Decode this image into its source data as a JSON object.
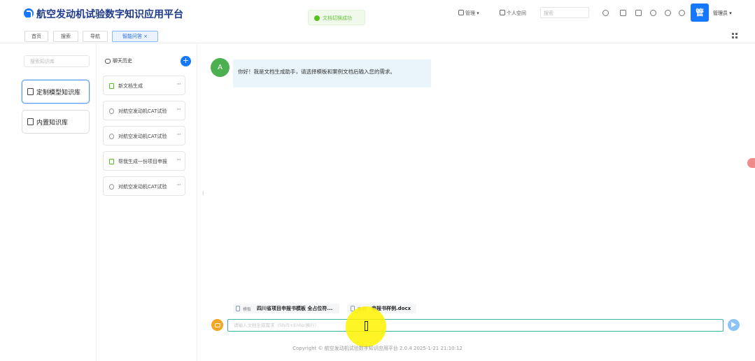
{
  "app": {
    "title": "航空发动机试验数字知识应用平台"
  },
  "toast": {
    "text": "文档切换成功"
  },
  "header": {
    "menu_manage": "管理",
    "personal_center": "个人空间",
    "search_placeholder": "搜索",
    "avatar_text": "管",
    "user_name": "管理员"
  },
  "tabs": [
    {
      "label": "首页"
    },
    {
      "label": "搜索"
    },
    {
      "label": "导航"
    },
    {
      "label": "智能问答"
    }
  ],
  "kb": {
    "search_placeholder": "搜索知识库",
    "items": [
      {
        "label": "定制模型知识库"
      },
      {
        "label": "内置知识库"
      }
    ]
  },
  "history": {
    "title": "聊天历史",
    "add_label": "+",
    "items": [
      {
        "label": "新文档生成",
        "icon": "document-icon"
      },
      {
        "label": "对航空发动机CAT试验",
        "icon": "chat-icon"
      },
      {
        "label": "对航空发动机CAT试验",
        "icon": "chat-icon"
      },
      {
        "label": "帮我生成一份项目申报",
        "icon": "document-icon"
      },
      {
        "label": "对航空发动机CAT试验",
        "icon": "chat-icon"
      }
    ],
    "more_label": "···"
  },
  "chat": {
    "bot_avatar": "A",
    "greeting": "你好！我是文档生成助手，请选择模板和案例文档后输入您的需求。",
    "attachments": [
      {
        "tag": "模板",
        "name": "四川省项目申报书模板 全占位符..."
      },
      {
        "tag": "案例",
        "name": "申报书样例.docx"
      }
    ],
    "input_placeholder": "请输入文档生成需求（Shift+Enter换行）"
  },
  "footer": {
    "copyright": "Copyright © 航空发动机试验数字知识应用平台 2.0.4 2025-1-21 21:10:12"
  },
  "colors": {
    "brand": "#1677ff",
    "title": "#1e3a8a",
    "success": "#52c41a",
    "input_border": "#39b5a7",
    "cursor_highlight": "#fff200"
  }
}
